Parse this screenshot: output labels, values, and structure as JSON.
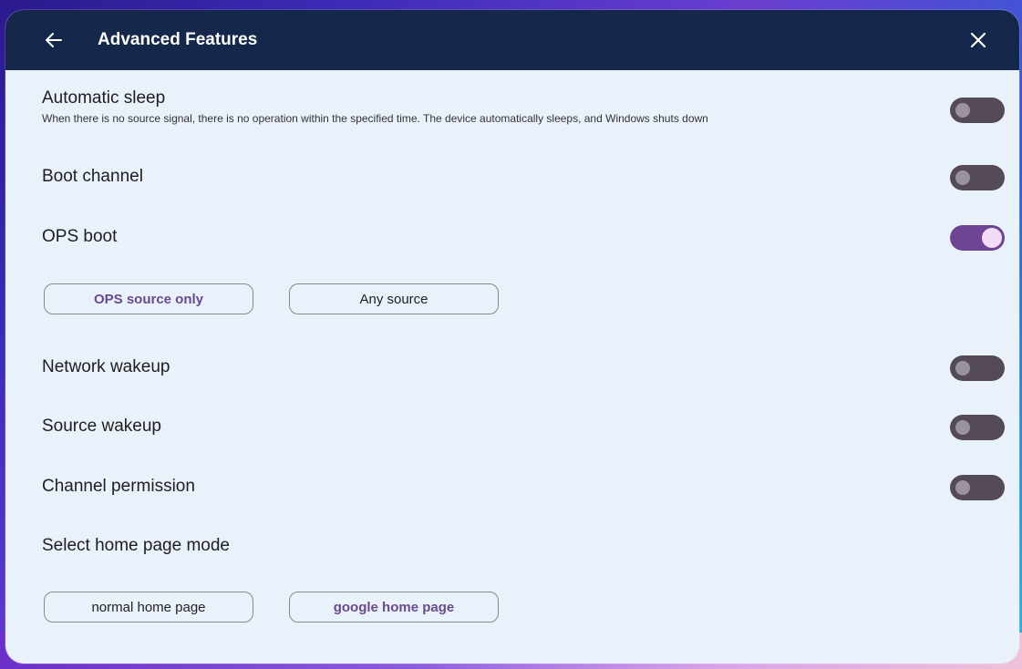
{
  "header": {
    "title": "Advanced Features"
  },
  "settings": {
    "automatic_sleep": {
      "label": "Automatic sleep",
      "description": "When there is no source signal, there is no operation within the specified time. The device automatically sleeps, and Windows shuts down",
      "enabled": false
    },
    "boot_channel": {
      "label": "Boot channel",
      "enabled": false
    },
    "ops_boot": {
      "label": "OPS boot",
      "enabled": true,
      "options": [
        "OPS source only",
        "Any source"
      ],
      "selected": "OPS source only"
    },
    "network_wakeup": {
      "label": "Network wakeup",
      "enabled": false
    },
    "source_wakeup": {
      "label": "Source wakeup",
      "enabled": false
    },
    "channel_permission": {
      "label": "Channel permission",
      "enabled": false
    },
    "home_page_mode": {
      "label": "Select home page mode",
      "options": [
        "normal home page",
        "google home page"
      ],
      "selected": "google home page"
    }
  },
  "colors": {
    "header_bg": "#15284c",
    "panel_bg": "#e9f1fa",
    "toggle_on": "#6e4595",
    "toggle_off": "#544a58",
    "selected_text": "#6a4a8c"
  },
  "icons": {
    "back": "arrow-left-icon",
    "close": "close-icon"
  }
}
